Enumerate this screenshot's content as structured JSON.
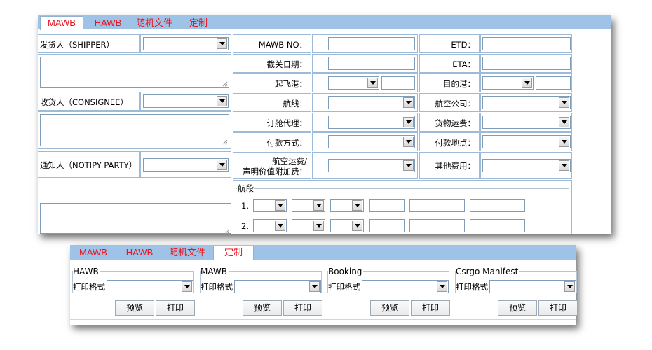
{
  "tabs": [
    {
      "label": "MAWB",
      "active": true
    },
    {
      "label": "HAWB",
      "active": false
    },
    {
      "label": "随机文件",
      "active": false
    },
    {
      "label": "定制",
      "active": false
    }
  ],
  "left_labels": {
    "shipper": "发货人（SHIPPER）",
    "consignee": "收货人（CONSIGNEE）",
    "notify": "通知人（NOTIPY PARTY）"
  },
  "mid_labels": {
    "mawb_no": "MAWB NO：",
    "customs_date": "截关日期：",
    "departure_port": "起飞港：",
    "route": "航线：",
    "booking_agent": "订舱代理：",
    "payment_method": "付款方式：",
    "air_freight_1": "航空运费/",
    "air_freight_2": "声明价值附加费："
  },
  "right_labels": {
    "etd": "ETD：",
    "eta": "ETA：",
    "destination_port": "目的港：",
    "airline": "航空公司：",
    "cargo_freight": "货物运费：",
    "payment_place": "付款地点：",
    "other_fees": "其他费用："
  },
  "segments": {
    "legend": "航段",
    "rows": [
      "1.",
      "2."
    ]
  },
  "bottom_tabs": [
    {
      "label": "MAWB",
      "active": false
    },
    {
      "label": "HAWB",
      "active": false
    },
    {
      "label": "随机文件",
      "active": false
    },
    {
      "label": "定制",
      "active": true
    }
  ],
  "print_groups": [
    {
      "title": "HAWB",
      "format_label": "打印格式",
      "preview": "预览",
      "print": "打印"
    },
    {
      "title": "MAWB",
      "format_label": "打印格式",
      "preview": "预览",
      "print": "打印"
    },
    {
      "title": "Booking",
      "format_label": "打印格式",
      "preview": "预览",
      "print": "打印"
    },
    {
      "title": "Csrgo Manifest",
      "format_label": "打印格式",
      "preview": "预览",
      "print": "打印"
    }
  ],
  "colors": {
    "tab_text": "#e8141f",
    "tab_bar": "#9fc3e7",
    "border": "#9dbad8"
  }
}
